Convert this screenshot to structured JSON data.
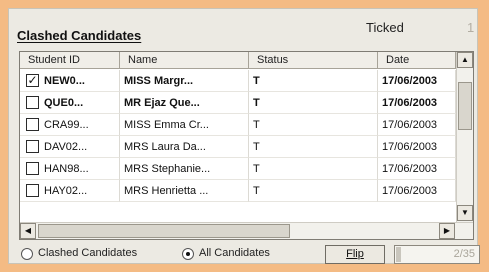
{
  "panel": {
    "title": "Clashed Candidates",
    "ticked_label": "Ticked",
    "ticked_count": "1"
  },
  "grid": {
    "columns": [
      "Student ID",
      "Name",
      "Status",
      "Date"
    ],
    "rows": [
      {
        "checked": true,
        "bold": true,
        "student_id": "NEW0...",
        "name": "MISS Margr...",
        "status": "T",
        "date": "17/06/2003"
      },
      {
        "checked": false,
        "bold": true,
        "student_id": "QUE0...",
        "name": "MR Ejaz Que...",
        "status": "T",
        "date": "17/06/2003"
      },
      {
        "checked": false,
        "bold": false,
        "student_id": "CRA99...",
        "name": "MISS Emma Cr...",
        "status": "T",
        "date": "17/06/2003"
      },
      {
        "checked": false,
        "bold": false,
        "student_id": "DAV02...",
        "name": "MRS Laura Da...",
        "status": "T",
        "date": "17/06/2003"
      },
      {
        "checked": false,
        "bold": false,
        "student_id": "HAN98...",
        "name": "MRS Stephanie...",
        "status": "T",
        "date": "17/06/2003"
      },
      {
        "checked": false,
        "bold": false,
        "student_id": "HAY02...",
        "name": "MRS Henrietta ...",
        "status": "T",
        "date": "17/06/2003"
      }
    ],
    "vscroll_position": 0.18,
    "hscroll_position": 0.0
  },
  "footer": {
    "radio_clashed_label": "Clashed Candidates",
    "radio_all_label": "All Candidates",
    "selected_radio": "all",
    "flip_label": "Flip",
    "progress_text": "2/35",
    "progress_fraction": 0.057
  },
  "colors": {
    "page_background": "#f4bb84",
    "panel_background": "#eceae3"
  }
}
